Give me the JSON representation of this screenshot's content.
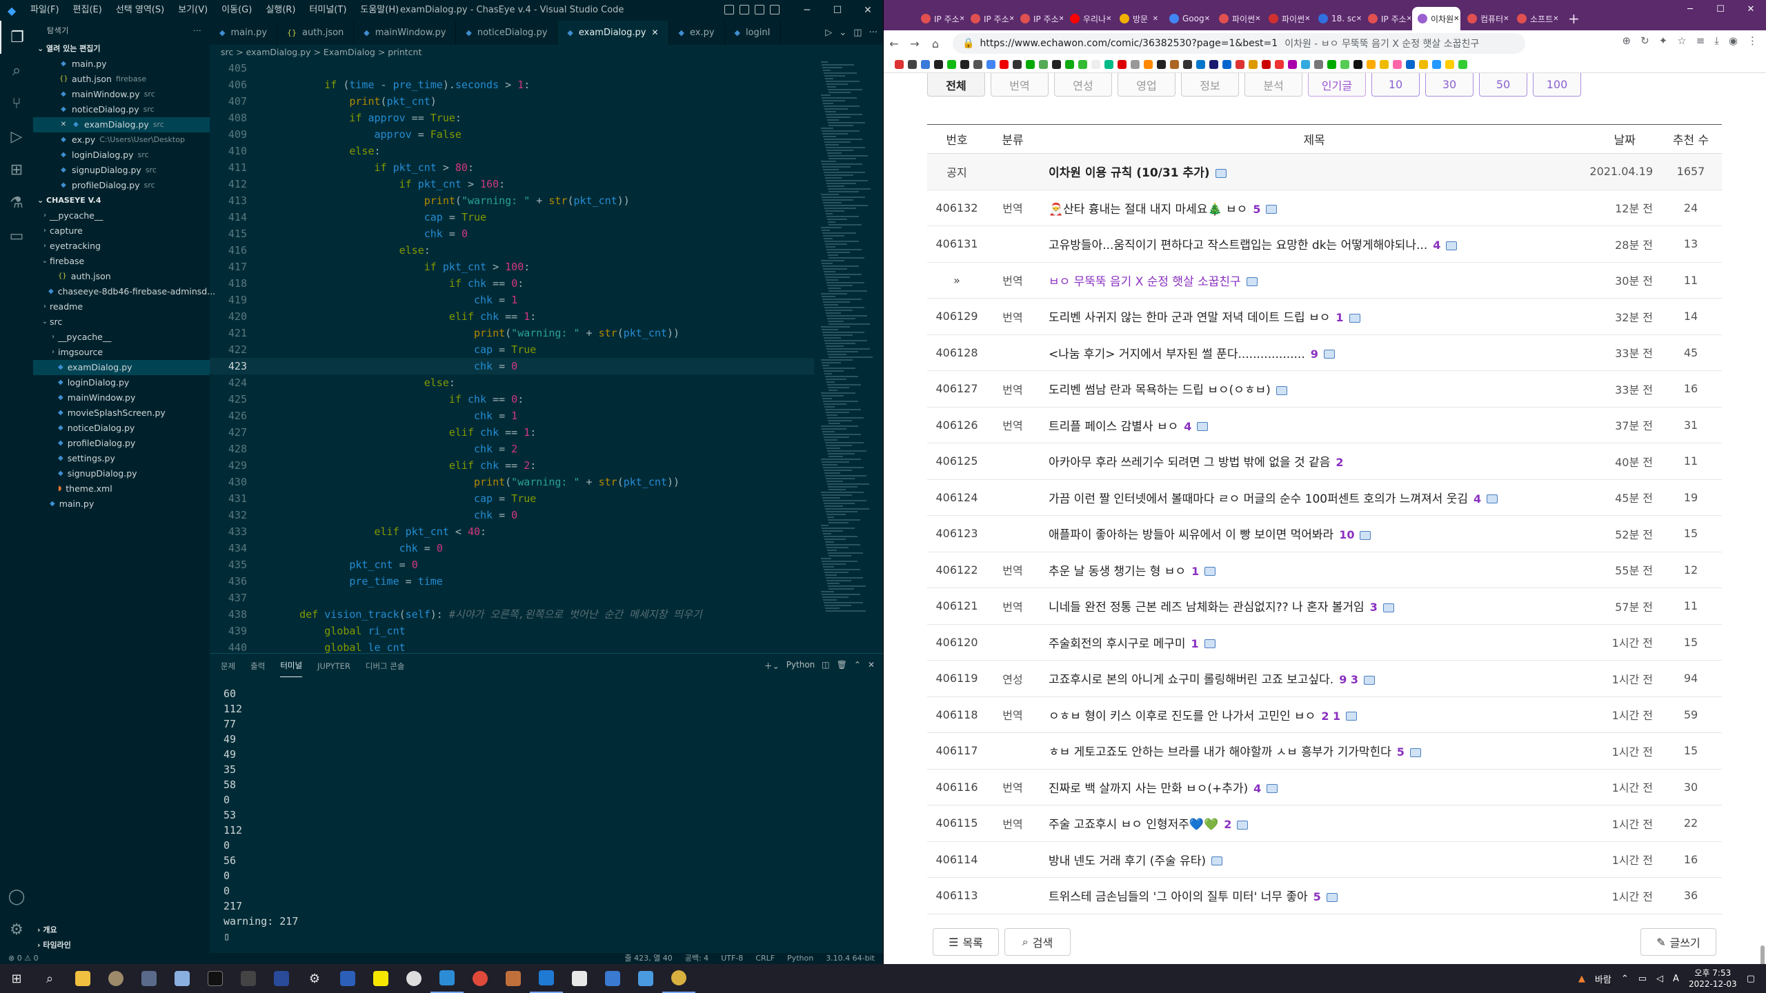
{
  "vscode": {
    "title": "examDialog.py - ChasEye v.4 - Visual Studio Code",
    "menu": [
      "파일(F)",
      "편집(E)",
      "선택 영역(S)",
      "보기(V)",
      "이동(G)",
      "실행(R)",
      "터미널(T)",
      "도움말(H)"
    ],
    "explorer_label": "탐색기",
    "open_editors_label": "열려 있는 편집기",
    "open_editors": [
      {
        "name": "main.py",
        "desc": "",
        "icon": "py"
      },
      {
        "name": "auth.json",
        "desc": "firebase",
        "icon": "json"
      },
      {
        "name": "mainWindow.py",
        "desc": "src",
        "icon": "py"
      },
      {
        "name": "noticeDialog.py",
        "desc": "src",
        "icon": "py"
      },
      {
        "name": "examDialog.py",
        "desc": "src",
        "icon": "py"
      },
      {
        "name": "ex.py",
        "desc": "C:\\Users\\User\\Desktop",
        "icon": "py"
      },
      {
        "name": "loginDialog.py",
        "desc": "src",
        "icon": "py"
      },
      {
        "name": "signupDialog.py",
        "desc": "src",
        "icon": "py"
      },
      {
        "name": "profileDialog.py",
        "desc": "src",
        "icon": "py"
      }
    ],
    "workspace_label": "CHASEYE V.4",
    "tree": [
      {
        "name": "__pycache__",
        "folder": true,
        "open": false,
        "depth": 0
      },
      {
        "name": "capture",
        "folder": true,
        "open": false,
        "depth": 0
      },
      {
        "name": "eyetracking",
        "folder": true,
        "open": false,
        "depth": 0
      },
      {
        "name": "firebase",
        "folder": true,
        "open": true,
        "depth": 0
      },
      {
        "name": "auth.json",
        "folder": false,
        "depth": 1
      },
      {
        "name": "chaseeye-8db46-firebase-adminsd...",
        "folder": false,
        "depth": 1
      },
      {
        "name": "readme",
        "folder": true,
        "open": false,
        "depth": 0
      },
      {
        "name": "src",
        "folder": true,
        "open": true,
        "depth": 0
      },
      {
        "name": "__pycache__",
        "folder": true,
        "open": false,
        "depth": 1
      },
      {
        "name": "imgsource",
        "folder": true,
        "open": false,
        "depth": 1
      },
      {
        "name": "examDialog.py",
        "folder": false,
        "depth": 1,
        "selected": true
      },
      {
        "name": "loginDialog.py",
        "folder": false,
        "depth": 1
      },
      {
        "name": "mainWindow.py",
        "folder": false,
        "depth": 1
      },
      {
        "name": "movieSplashScreen.py",
        "folder": false,
        "depth": 1
      },
      {
        "name": "noticeDialog.py",
        "folder": false,
        "depth": 1
      },
      {
        "name": "profileDialog.py",
        "folder": false,
        "depth": 1
      },
      {
        "name": "settings.py",
        "folder": false,
        "depth": 1
      },
      {
        "name": "signupDialog.py",
        "folder": false,
        "depth": 1
      },
      {
        "name": "theme.xml",
        "folder": false,
        "depth": 1
      },
      {
        "name": "main.py",
        "folder": false,
        "depth": 0
      }
    ],
    "outline_label": "개요",
    "timeline_label": "타임라인",
    "tabs": [
      {
        "name": "main.py",
        "active": false
      },
      {
        "name": "auth.json",
        "active": false
      },
      {
        "name": "mainWindow.py",
        "active": false
      },
      {
        "name": "noticeDialog.py",
        "active": false
      },
      {
        "name": "examDialog.py",
        "active": true
      },
      {
        "name": "ex.py",
        "active": false
      },
      {
        "name": "loginI",
        "active": false
      }
    ],
    "breadcrumb": "src > examDialog.py > ExamDialog > printcnt",
    "code_lines": [
      {
        "n": 405,
        "t": ""
      },
      {
        "n": 406,
        "t": "        if (time - pre_time).seconds > 1:"
      },
      {
        "n": 407,
        "t": "            print(pkt_cnt)"
      },
      {
        "n": 408,
        "t": "            if approv == True:"
      },
      {
        "n": 409,
        "t": "                approv = False"
      },
      {
        "n": 410,
        "t": "            else:"
      },
      {
        "n": 411,
        "t": "                if pkt_cnt > 80:"
      },
      {
        "n": 412,
        "t": "                    if pkt_cnt > 160:"
      },
      {
        "n": 413,
        "t": "                        print(\"warning: \" + str(pkt_cnt))"
      },
      {
        "n": 414,
        "t": "                        cap = True"
      },
      {
        "n": 415,
        "t": "                        chk = 0"
      },
      {
        "n": 416,
        "t": "                    else:"
      },
      {
        "n": 417,
        "t": "                        if pkt_cnt > 100:"
      },
      {
        "n": 418,
        "t": "                            if chk == 0:"
      },
      {
        "n": 419,
        "t": "                                chk = 1"
      },
      {
        "n": 420,
        "t": "                            elif chk == 1:"
      },
      {
        "n": 421,
        "t": "                                print(\"warning: \" + str(pkt_cnt))"
      },
      {
        "n": 422,
        "t": "                                cap = True"
      },
      {
        "n": 423,
        "t": "                                chk = 0"
      },
      {
        "n": 424,
        "t": "                        else:"
      },
      {
        "n": 425,
        "t": "                            if chk == 0:"
      },
      {
        "n": 426,
        "t": "                                chk = 1"
      },
      {
        "n": 427,
        "t": "                            elif chk == 1:"
      },
      {
        "n": 428,
        "t": "                                chk = 2"
      },
      {
        "n": 429,
        "t": "                            elif chk == 2:"
      },
      {
        "n": 430,
        "t": "                                print(\"warning: \" + str(pkt_cnt))"
      },
      {
        "n": 431,
        "t": "                                cap = True"
      },
      {
        "n": 432,
        "t": "                                chk = 0"
      },
      {
        "n": 433,
        "t": "                elif pkt_cnt < 40:"
      },
      {
        "n": 434,
        "t": "                    chk = 0"
      },
      {
        "n": 435,
        "t": "            pkt_cnt = 0"
      },
      {
        "n": 436,
        "t": "            pre_time = time"
      },
      {
        "n": 437,
        "t": ""
      },
      {
        "n": 438,
        "t": "    def vision_track(self): #시야가 오른쪽,왼쪽으로 벗어난 순간 메세지창 띄우기"
      },
      {
        "n": 439,
        "t": "        global ri_cnt"
      },
      {
        "n": 440,
        "t": "        global le_cnt"
      }
    ],
    "current_line": 423,
    "panel_tabs": [
      "문제",
      "출력",
      "터미널",
      "JUPYTER",
      "디버그 콘솔"
    ],
    "panel_active": "터미널",
    "panel_shell": "Python",
    "terminal_lines": [
      "60",
      "112",
      "77",
      "49",
      "49",
      "35",
      "58",
      "0",
      "53",
      "112",
      "0",
      "56",
      "0",
      "0",
      "217",
      "warning: 217",
      "▯"
    ],
    "status_left": "⊗ 0 ⚠ 0",
    "status_right": [
      "줄 423, 열 40",
      "공백: 4",
      "UTF-8",
      "CRLF",
      "Python",
      "3.10.4 64-bit"
    ]
  },
  "browser": {
    "tabs": [
      {
        "label": "IP 주소",
        "color": "#e05050"
      },
      {
        "label": "IP 주소",
        "color": "#e05050"
      },
      {
        "label": "IP 주소",
        "color": "#e05050"
      },
      {
        "label": "우리나",
        "color": "#ff0000"
      },
      {
        "label": "방문",
        "color": "#f0b000"
      },
      {
        "label": "Goog",
        "color": "#4285f4"
      },
      {
        "label": "파이썬",
        "color": "#e05050"
      },
      {
        "label": "파이썬",
        "color": "#d03030"
      },
      {
        "label": "18. sc",
        "color": "#3070e0"
      },
      {
        "label": "IP 주소",
        "color": "#e05050"
      },
      {
        "label": "이차원",
        "color": "#9a60d0",
        "active": true
      },
      {
        "label": "컴퓨터",
        "color": "#e05050"
      },
      {
        "label": "소프트",
        "color": "#e05050"
      }
    ],
    "url": "https://www.echawon.com/comic/36382530?page=1&best=1",
    "page_title": "이차원 - ㅂㅇ 무뚝뚝 음기 X 순정 햇살 소꿉친구",
    "filters": [
      {
        "label": "전체",
        "style": "on"
      },
      {
        "label": "번역",
        "style": ""
      },
      {
        "label": "연성",
        "style": ""
      },
      {
        "label": "영업",
        "style": ""
      },
      {
        "label": "정보",
        "style": ""
      },
      {
        "label": "분석",
        "style": ""
      },
      {
        "label": "인기글",
        "style": "pink"
      },
      {
        "label": "10",
        "style": "num"
      },
      {
        "label": "30",
        "style": "num"
      },
      {
        "label": "50",
        "style": "num"
      },
      {
        "label": "100",
        "style": "num"
      }
    ],
    "headers": {
      "no": "번호",
      "cat": "분류",
      "title": "제목",
      "date": "날짜",
      "rec": "추천 수"
    },
    "rows": [
      {
        "no": "공지",
        "cat": "",
        "title": "이차원 이용 규칙 (10/31 추가)",
        "comments": "",
        "img": true,
        "date": "2021.04.19",
        "rec": "1657",
        "notice": true
      },
      {
        "no": "406132",
        "cat": "번역",
        "title": "🎅산타 흉내는 절대 내지 마세요🎄 ㅂㅇ",
        "comments": "5",
        "img": true,
        "date": "12분 전",
        "rec": "24"
      },
      {
        "no": "406131",
        "cat": "",
        "title": "고유방들아...움직이기 편하다고 작스트랩입는 요망한 dk는 어떻게해야되나...",
        "comments": "4",
        "img": true,
        "date": "28분 전",
        "rec": "13"
      },
      {
        "no": "»",
        "cat": "번역",
        "title": "ㅂㅇ 무뚝뚝 음기 X 순정 햇살 소꿉친구",
        "comments": "",
        "img": true,
        "date": "30분 전",
        "rec": "11",
        "visited": true
      },
      {
        "no": "406129",
        "cat": "번역",
        "title": "도리벤 사귀지 않는 한마 군과 연말 저녁 데이트 드립 ㅂㅇ",
        "comments": "1",
        "img": true,
        "date": "32분 전",
        "rec": "14"
      },
      {
        "no": "406128",
        "cat": "",
        "title": "<나눔 후기> 거지에서 부자된 썰 푼다..................",
        "comments": "9",
        "img": true,
        "date": "33분 전",
        "rec": "45"
      },
      {
        "no": "406127",
        "cat": "번역",
        "title": "도리벤 썸남 란과 목욕하는 드립 ㅂㅇ(ㅇㅎㅂ)",
        "comments": "",
        "img": true,
        "date": "33분 전",
        "rec": "16"
      },
      {
        "no": "406126",
        "cat": "번역",
        "title": "트리플 페이스 감별사 ㅂㅇ",
        "comments": "4",
        "img": true,
        "date": "37분 전",
        "rec": "31"
      },
      {
        "no": "406125",
        "cat": "",
        "title": "아카아무 후라 쓰레기수 되려면 그 방법 밖에 없을 것 같음",
        "comments": "2",
        "img": false,
        "date": "40분 전",
        "rec": "11"
      },
      {
        "no": "406124",
        "cat": "",
        "title": "가끔 이런 짤 인터넷에서 볼때마다 ㄹㅇ 머글의 순수 100퍼센트 호의가 느껴져서 웃김",
        "comments": "4",
        "img": true,
        "date": "45분 전",
        "rec": "19"
      },
      {
        "no": "406123",
        "cat": "",
        "title": "애플파이 좋아하는 방들아 씨유에서 이 빵 보이면 먹어봐라",
        "comments": "10",
        "img": true,
        "date": "52분 전",
        "rec": "15"
      },
      {
        "no": "406122",
        "cat": "번역",
        "title": "추운 날 동생 챙기는 형 ㅂㅇ",
        "comments": "1",
        "img": true,
        "date": "55분 전",
        "rec": "12"
      },
      {
        "no": "406121",
        "cat": "번역",
        "title": "니네들 완전 정통 근본 레즈 남체화는 관심없지?? 나 혼자 볼거임",
        "comments": "3",
        "img": true,
        "date": "57분 전",
        "rec": "11"
      },
      {
        "no": "406120",
        "cat": "",
        "title": "주술회전의 후시구로 메구미",
        "comments": "1",
        "img": true,
        "date": "1시간 전",
        "rec": "15"
      },
      {
        "no": "406119",
        "cat": "연성",
        "title": "고죠후시로 본의 아니게 쇼구미 롤링해버린 고죠 보고싶다.",
        "comments": "9 3",
        "img": true,
        "date": "1시간 전",
        "rec": "94"
      },
      {
        "no": "406118",
        "cat": "번역",
        "title": "ㅇㅎㅂ 형이 키스 이후로 진도를 안 나가서 고민인 ㅂㅇ",
        "comments": "2 1",
        "img": true,
        "date": "1시간 전",
        "rec": "59"
      },
      {
        "no": "406117",
        "cat": "",
        "title": "ㅎㅂ 게토고죠도 안하는 브라를 내가 해야할까 ㅅㅂ 흥부가 기가막힌다",
        "comments": "5",
        "img": true,
        "date": "1시간 전",
        "rec": "15"
      },
      {
        "no": "406116",
        "cat": "번역",
        "title": "진짜로 백 살까지 사는 만화 ㅂㅇ(+추가)",
        "comments": "4",
        "img": true,
        "date": "1시간 전",
        "rec": "30"
      },
      {
        "no": "406115",
        "cat": "번역",
        "title": "주술 고죠후시 ㅂㅇ 인형저주💙💚",
        "comments": "2",
        "img": true,
        "date": "1시간 전",
        "rec": "22"
      },
      {
        "no": "406114",
        "cat": "",
        "title": "방내 넨도 거래 후기 (주술 유타)",
        "comments": "",
        "img": true,
        "date": "1시간 전",
        "rec": "16"
      },
      {
        "no": "406113",
        "cat": "",
        "title": "트위스테 금손님들의 '그 아이의 질투 미터' 너무 좋아",
        "comments": "5",
        "img": true,
        "date": "1시간 전",
        "rec": "36"
      }
    ],
    "list_button": "목록",
    "search_button": "검색",
    "write_button": "글쓰기"
  },
  "taskbar": {
    "weather": "바람",
    "time": "오후 7:53",
    "date": "2022-12-03"
  }
}
